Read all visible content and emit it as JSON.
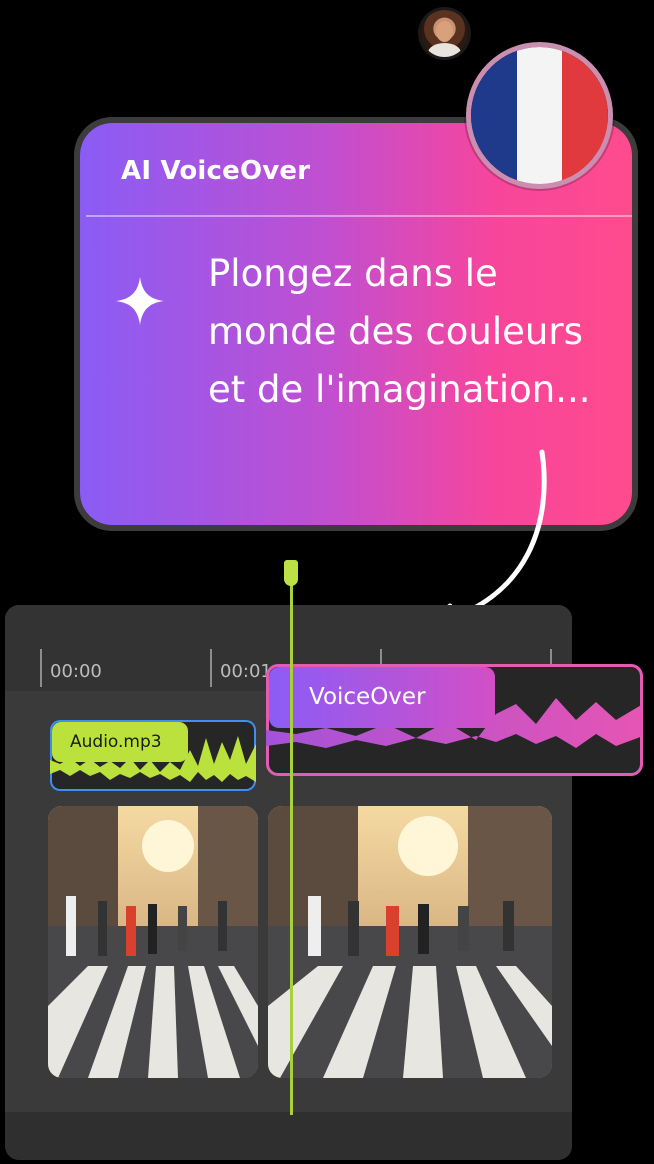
{
  "card": {
    "title": "AI VoiceOver",
    "text": "Plongez dans le monde des couleurs et de l'imagination...",
    "sparkle_icon": "sparkle-icon",
    "gradient_colors": [
      "#8a5cf5",
      "#f7459c"
    ]
  },
  "flag": {
    "country": "France",
    "colors": [
      "#1f3a8a",
      "#ffffff",
      "#e03a3e"
    ]
  },
  "timeline": {
    "ticks": [
      "00:00",
      "00:01"
    ],
    "audio_clip": {
      "label": "Audio.mp3",
      "color": "#bbe23c"
    },
    "voiceover_clip": {
      "label": "VoiceOver",
      "color": "#d24fc6"
    },
    "playhead_color": "#a6d13a"
  }
}
